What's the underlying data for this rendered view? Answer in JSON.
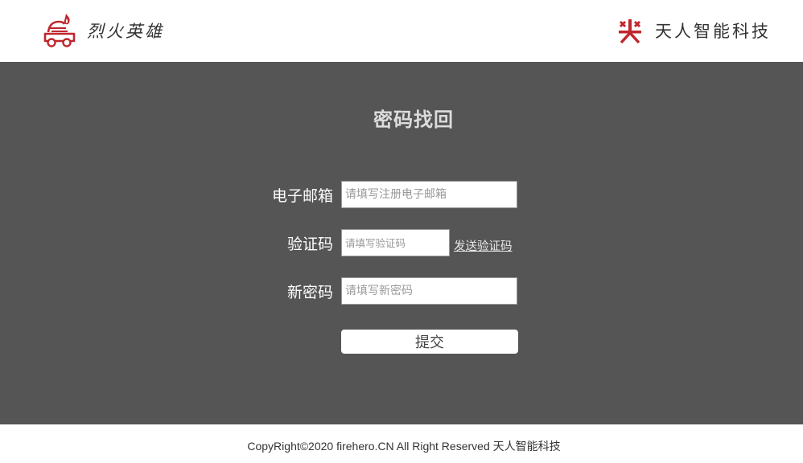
{
  "header": {
    "left_brand": {
      "name": "烈火英雄",
      "logo_icon": "fire-car-logo-icon"
    },
    "right_brand": {
      "name": "天人智能科技",
      "logo_icon": "tianren-mark-icon"
    }
  },
  "form": {
    "title": "密码找回",
    "email": {
      "label": "电子邮箱",
      "placeholder": "请填写注册电子邮箱",
      "value": ""
    },
    "code": {
      "label": "验证码",
      "placeholder": "请填写验证码",
      "value": "",
      "send_link": "发送验证码"
    },
    "new_password": {
      "label": "新密码",
      "placeholder": "请填写新密码",
      "value": ""
    },
    "submit_label": "提交"
  },
  "footer": {
    "copyright": "CopyRight©2020 firehero.CN All Right Reserved 天人智能科技"
  },
  "colors": {
    "main_background": "#555555",
    "header_background": "#ffffff",
    "brand_red": "#c0262d",
    "title_text": "#dddddd"
  }
}
